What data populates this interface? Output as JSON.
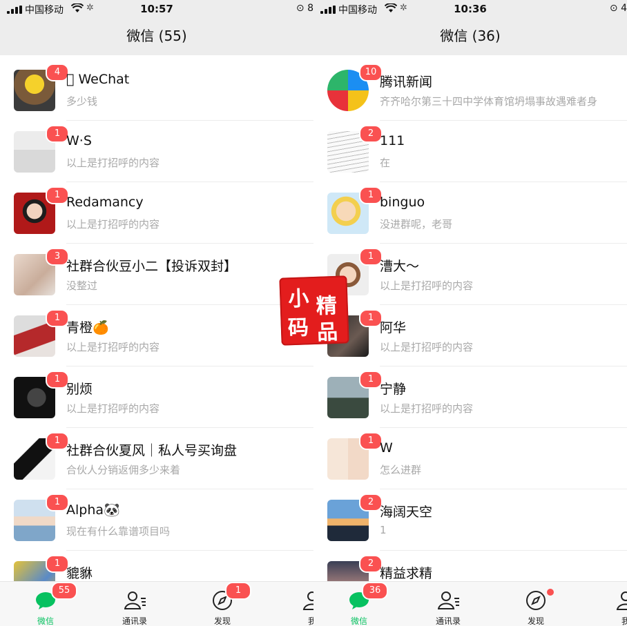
{
  "left": {
    "status": {
      "carrier": "中国移动",
      "time": "10:57",
      "right": "8"
    },
    "title": "微信 (55)",
    "chats": [
      {
        "name": "WeChat",
        "prefix_icon": "apple-icon",
        "preview": "多少钱",
        "badge": "4"
      },
      {
        "name": "W·S",
        "preview": "以上是打招呼的内容",
        "badge": "1"
      },
      {
        "name": "Redamancy",
        "preview": "以上是打招呼的内容",
        "badge": "1"
      },
      {
        "name": "社群合伙豆小二【投诉双封】",
        "preview": "没整过",
        "badge": "3"
      },
      {
        "name": "青橙🍊",
        "preview": "以上是打招呼的内容",
        "badge": "1"
      },
      {
        "name": "别烦",
        "preview": "以上是打招呼的内容",
        "badge": "1"
      },
      {
        "name": "社群合伙夏风｜私人号买询盘",
        "preview": "合伙人分销返佣多少来着",
        "badge": "1"
      },
      {
        "name": "Alpha🐼",
        "preview": "现在有什么靠谱项目吗",
        "badge": "1"
      },
      {
        "name": "貔貅",
        "preview": "",
        "badge": "1"
      }
    ],
    "tabs": [
      {
        "label": "微信",
        "badge": "55",
        "icon": "chat-bubble-icon"
      },
      {
        "label": "通讯录",
        "badge": "",
        "icon": "contacts-icon"
      },
      {
        "label": "发现",
        "badge": "1",
        "icon": "compass-icon"
      },
      {
        "label": "我",
        "badge": "",
        "icon": "person-icon"
      }
    ]
  },
  "right": {
    "status": {
      "carrier": "中国移动",
      "time": "10:36",
      "right": "4"
    },
    "title": "微信 (36)",
    "chats": [
      {
        "name": "腾讯新闻",
        "preview": "齐齐哈尔第三十四中学体育馆坍塌事故遇难者身",
        "badge": "10"
      },
      {
        "name": "111",
        "preview": "在",
        "badge": "2"
      },
      {
        "name": "binguo",
        "preview": "没进群呢，老哥",
        "badge": "1"
      },
      {
        "name": "漕大～",
        "preview": "以上是打招呼的内容",
        "badge": "1"
      },
      {
        "name": "阿华",
        "preview": "以上是打招呼的内容",
        "badge": "1"
      },
      {
        "name": "宁静",
        "preview": "以上是打招呼的内容",
        "badge": "1"
      },
      {
        "name": "W",
        "preview": "怎么进群",
        "badge": "1"
      },
      {
        "name": "海阔天空",
        "preview": "1",
        "badge": "2"
      },
      {
        "name": "精益求精",
        "preview": "",
        "badge": "2"
      }
    ],
    "tabs": [
      {
        "label": "微信",
        "badge": "36",
        "icon": "chat-bubble-icon"
      },
      {
        "label": "通讯录",
        "badge": "",
        "icon": "contacts-icon"
      },
      {
        "label": "发现",
        "badge": "dot",
        "icon": "compass-icon"
      },
      {
        "label": "我",
        "badge": "",
        "icon": "person-icon"
      }
    ]
  },
  "watermark": {
    "chars": [
      "小",
      "精",
      "码",
      "品"
    ]
  },
  "colors": {
    "accent": "#07c160",
    "badge": "#fa5151",
    "nav_bg": "#ededed",
    "preview": "#a8a8a8"
  }
}
